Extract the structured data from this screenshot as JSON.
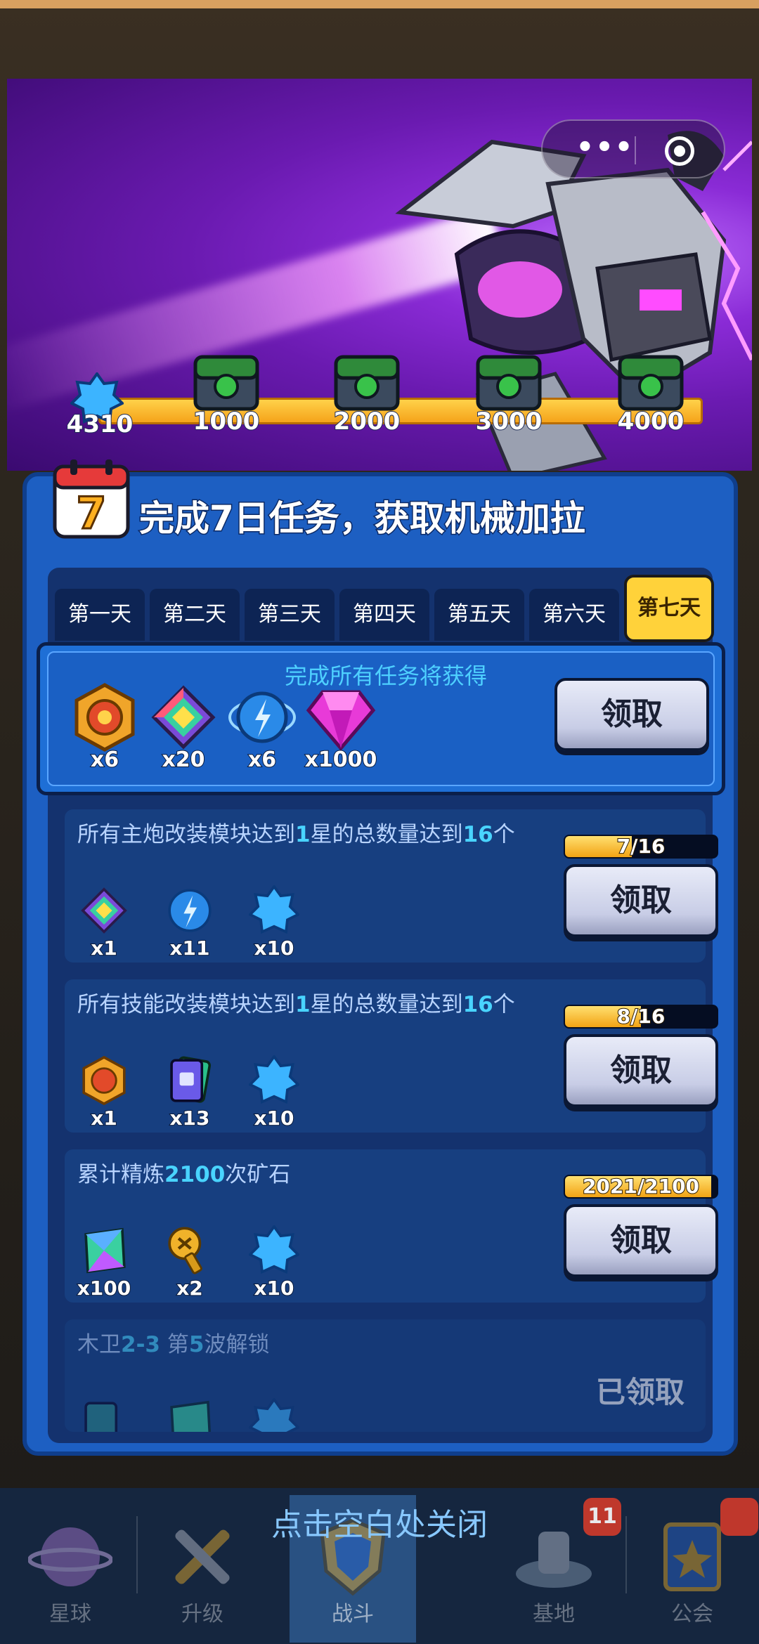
{
  "capsule": {
    "more_icon": "more-dots-icon",
    "target_icon": "record-target-icon",
    "more_glyph": "•••"
  },
  "progress_track": {
    "current_points": "4310",
    "milestones": [
      "1000",
      "2000",
      "3000",
      "4000"
    ]
  },
  "panel": {
    "title": "完成7日任务，获取机械加拉",
    "calendar_day": "7",
    "tabs": [
      "第一天",
      "第二天",
      "第三天",
      "第四天",
      "第五天",
      "第六天",
      "第七天"
    ],
    "active_tab": "第七天"
  },
  "bonus": {
    "title": "完成所有任务将获得",
    "rewards": [
      {
        "icon": "gold-medal-icon",
        "qty": "x6"
      },
      {
        "icon": "rainbow-chip-icon",
        "qty": "x20"
      },
      {
        "icon": "blue-energy-orb-icon",
        "qty": "x6"
      },
      {
        "icon": "pink-gem-icon",
        "qty": "x1000"
      }
    ],
    "button": "领取"
  },
  "tasks": [
    {
      "title_parts": [
        "所有主炮改装模块达到",
        "1",
        "星的总数量达到",
        "16",
        "个"
      ],
      "progress": "7/16",
      "progress_fraction": 0.4375,
      "rewards": [
        {
          "icon": "rainbow-chip-icon",
          "qty": "x1"
        },
        {
          "icon": "blue-energy-orb-icon",
          "qty": "x11"
        },
        {
          "icon": "blue-star-badge-icon",
          "qty": "x10"
        }
      ],
      "button": "领取"
    },
    {
      "title_parts": [
        "所有技能改装模块达到",
        "1",
        "星的总数量达到",
        "16",
        "个"
      ],
      "progress": "8/16",
      "progress_fraction": 0.5,
      "rewards": [
        {
          "icon": "gold-medal-icon",
          "qty": "x1"
        },
        {
          "icon": "skill-card-icon",
          "qty": "x13"
        },
        {
          "icon": "blue-star-badge-icon",
          "qty": "x10"
        }
      ],
      "button": "领取"
    },
    {
      "title_parts": [
        "累计精炼",
        "2100",
        "次矿石"
      ],
      "progress": "2021/2100",
      "progress_fraction": 0.9624,
      "rewards": [
        {
          "icon": "rainbow-crystal-icon",
          "qty": "x100"
        },
        {
          "icon": "gold-screw-icon",
          "qty": "x2"
        },
        {
          "icon": "blue-star-badge-icon",
          "qty": "x10"
        }
      ],
      "button": "领取"
    },
    {
      "title_parts": [
        "木卫",
        "2-3",
        " 第",
        "5",
        "波解锁"
      ],
      "status": "已领取"
    }
  ],
  "close_hint": "点击空白处关闭",
  "nav": {
    "items": [
      "星球",
      "升级",
      "战斗",
      "基地",
      "公会"
    ],
    "active": "战斗",
    "base_badge": "11"
  },
  "colors": {
    "panel": "#1d5fc2",
    "tab_active": "#ffd23a",
    "highlight_text": "#49d4ff",
    "progress_fill": "#f2a314"
  }
}
